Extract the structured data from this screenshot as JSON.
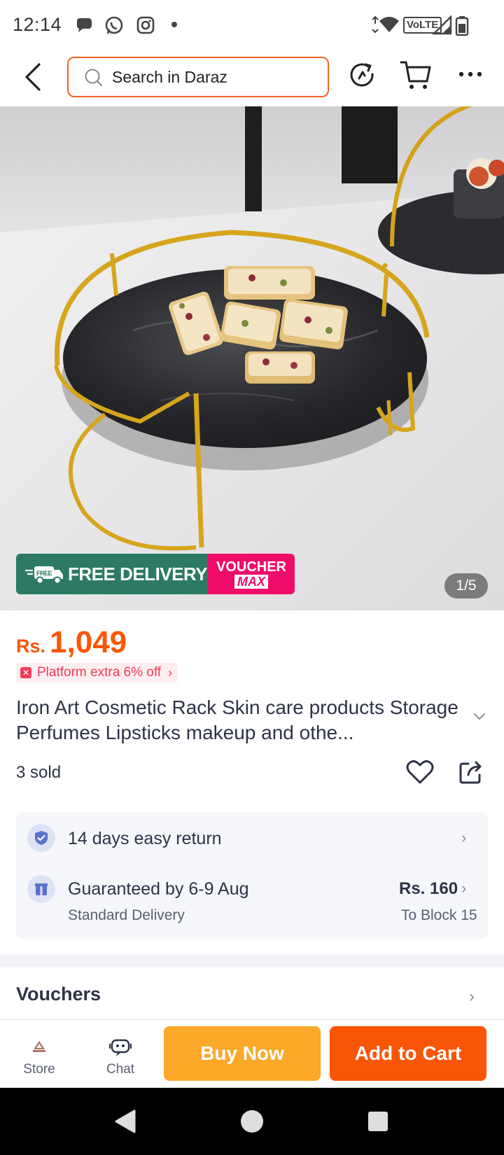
{
  "status_bar": {
    "time": "12:14",
    "network_label": "VoLTE"
  },
  "header": {
    "search_placeholder": "Search in Daraz"
  },
  "gallery": {
    "badge_free_small": "FREE",
    "badge_free_delivery": "FREE DELIVERY",
    "badge_voucher": "VOUCHER",
    "badge_max": "MAX",
    "counter": "1/5"
  },
  "product": {
    "currency": "Rs.",
    "price": "1,049",
    "promo": "Platform extra 6% off",
    "title": "Iron Art Cosmetic Rack Skin care products Storage Perfumes Lipsticks makeup and othe...",
    "sold": "3 sold"
  },
  "services": {
    "return_text": "14 days easy return",
    "delivery_text": "Guaranteed by 6-9 Aug",
    "delivery_sub": "Standard Delivery",
    "delivery_price": "Rs. 160",
    "delivery_location": "To Block 15"
  },
  "vouchers": {
    "label": "Vouchers"
  },
  "bottom_bar": {
    "store_label": "Store",
    "chat_label": "Chat",
    "buy_now": "Buy Now",
    "add_to_cart": "Add to Cart"
  },
  "colors": {
    "accent": "#f85606",
    "buy_now": "#fca829",
    "free_delivery_green": "#2c7a63",
    "voucher_pink": "#ef0c69"
  }
}
